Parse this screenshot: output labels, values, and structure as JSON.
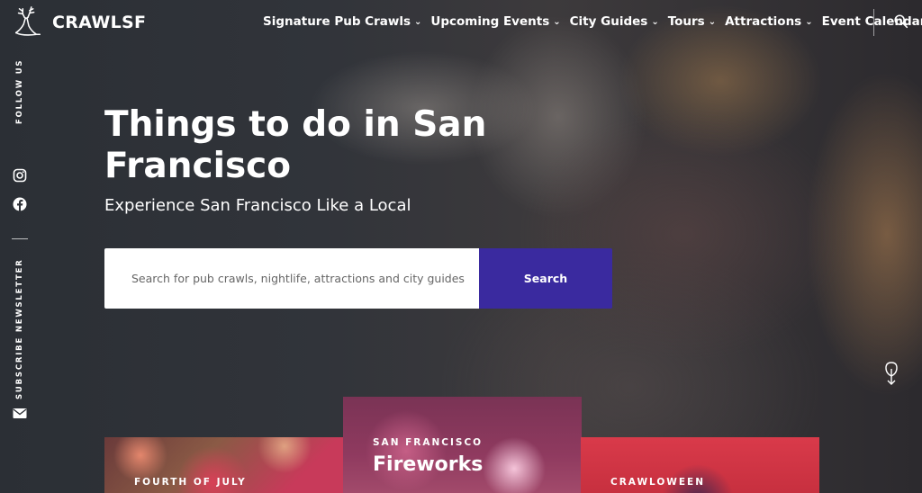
{
  "brand": {
    "name": "CRAWLSF",
    "logo_icon": "stag-logo-icon"
  },
  "nav": {
    "items": [
      {
        "label": "Signature Pub Crawls"
      },
      {
        "label": "Upcoming Events"
      },
      {
        "label": "City Guides"
      },
      {
        "label": "Tours"
      },
      {
        "label": "Attractions"
      },
      {
        "label": "Event Calendar"
      }
    ],
    "dropdown_icon": "chevron-down-icon",
    "search_icon": "search-icon"
  },
  "rail": {
    "follow_label": "FOLLOW US",
    "social_icons": [
      "instagram-icon",
      "facebook-icon"
    ],
    "newsletter_label": "SUBSCRIBE NEWSLETTER",
    "newsletter_icon": "mail-icon"
  },
  "hero": {
    "title": "Things to do in San Francisco",
    "subtitle": "Experience San Francisco Like a Local",
    "search_placeholder": "Search for pub crawls, nightlife, attractions and city guides",
    "search_button": "Search"
  },
  "cards": [
    {
      "kicker": "FOURTH OF JULY",
      "title": ""
    },
    {
      "kicker": "SAN FRANCISCO",
      "title": "Fireworks"
    },
    {
      "kicker": "CRAWLOWEEN",
      "title": ""
    }
  ],
  "colors": {
    "search_button": "#3a2a9f",
    "text": "#ffffff"
  }
}
